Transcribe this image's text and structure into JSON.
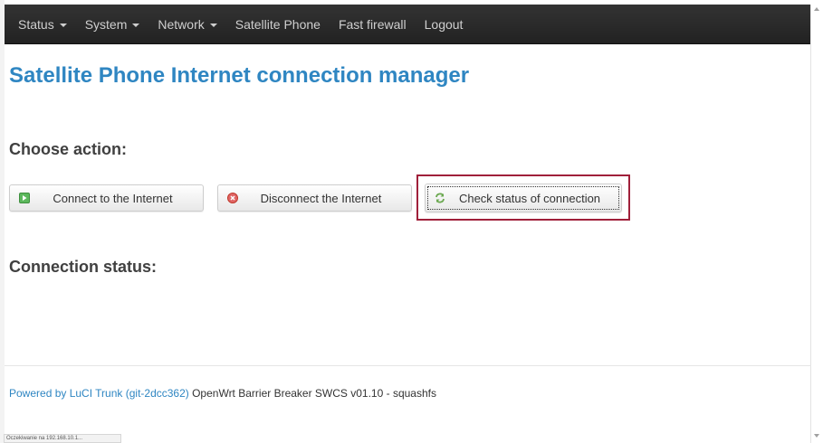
{
  "nav": {
    "items": [
      {
        "label": "Status",
        "dropdown": true
      },
      {
        "label": "System",
        "dropdown": true
      },
      {
        "label": "Network",
        "dropdown": true
      },
      {
        "label": "Satellite Phone",
        "dropdown": false
      },
      {
        "label": "Fast firewall",
        "dropdown": false
      },
      {
        "label": "Logout",
        "dropdown": false
      }
    ]
  },
  "main": {
    "title": "Satellite Phone Internet connection manager",
    "choose_action_heading": "Choose action:",
    "buttons": {
      "connect": {
        "label": "Connect to the Internet",
        "icon": "play-icon",
        "color": "#5cb85c"
      },
      "disconnect": {
        "label": "Disconnect the Internet",
        "icon": "close-icon",
        "color": "#d9534f"
      },
      "check": {
        "label": "Check status of connection",
        "icon": "refresh-icon",
        "color": "#6aa84f"
      }
    },
    "connection_status_heading": "Connection status:"
  },
  "footer": {
    "link_text": "Powered by LuCI Trunk (git-2dcc362)",
    "text": " OpenWrt Barrier Breaker SWCS v01.10 - squashfs"
  },
  "statusbar": {
    "text": "Oczekiwanie na 192.168.10.1..."
  },
  "colors": {
    "accent": "#2f86c2",
    "navbar": "#2c2c2c",
    "highlight": "#a0203a"
  }
}
